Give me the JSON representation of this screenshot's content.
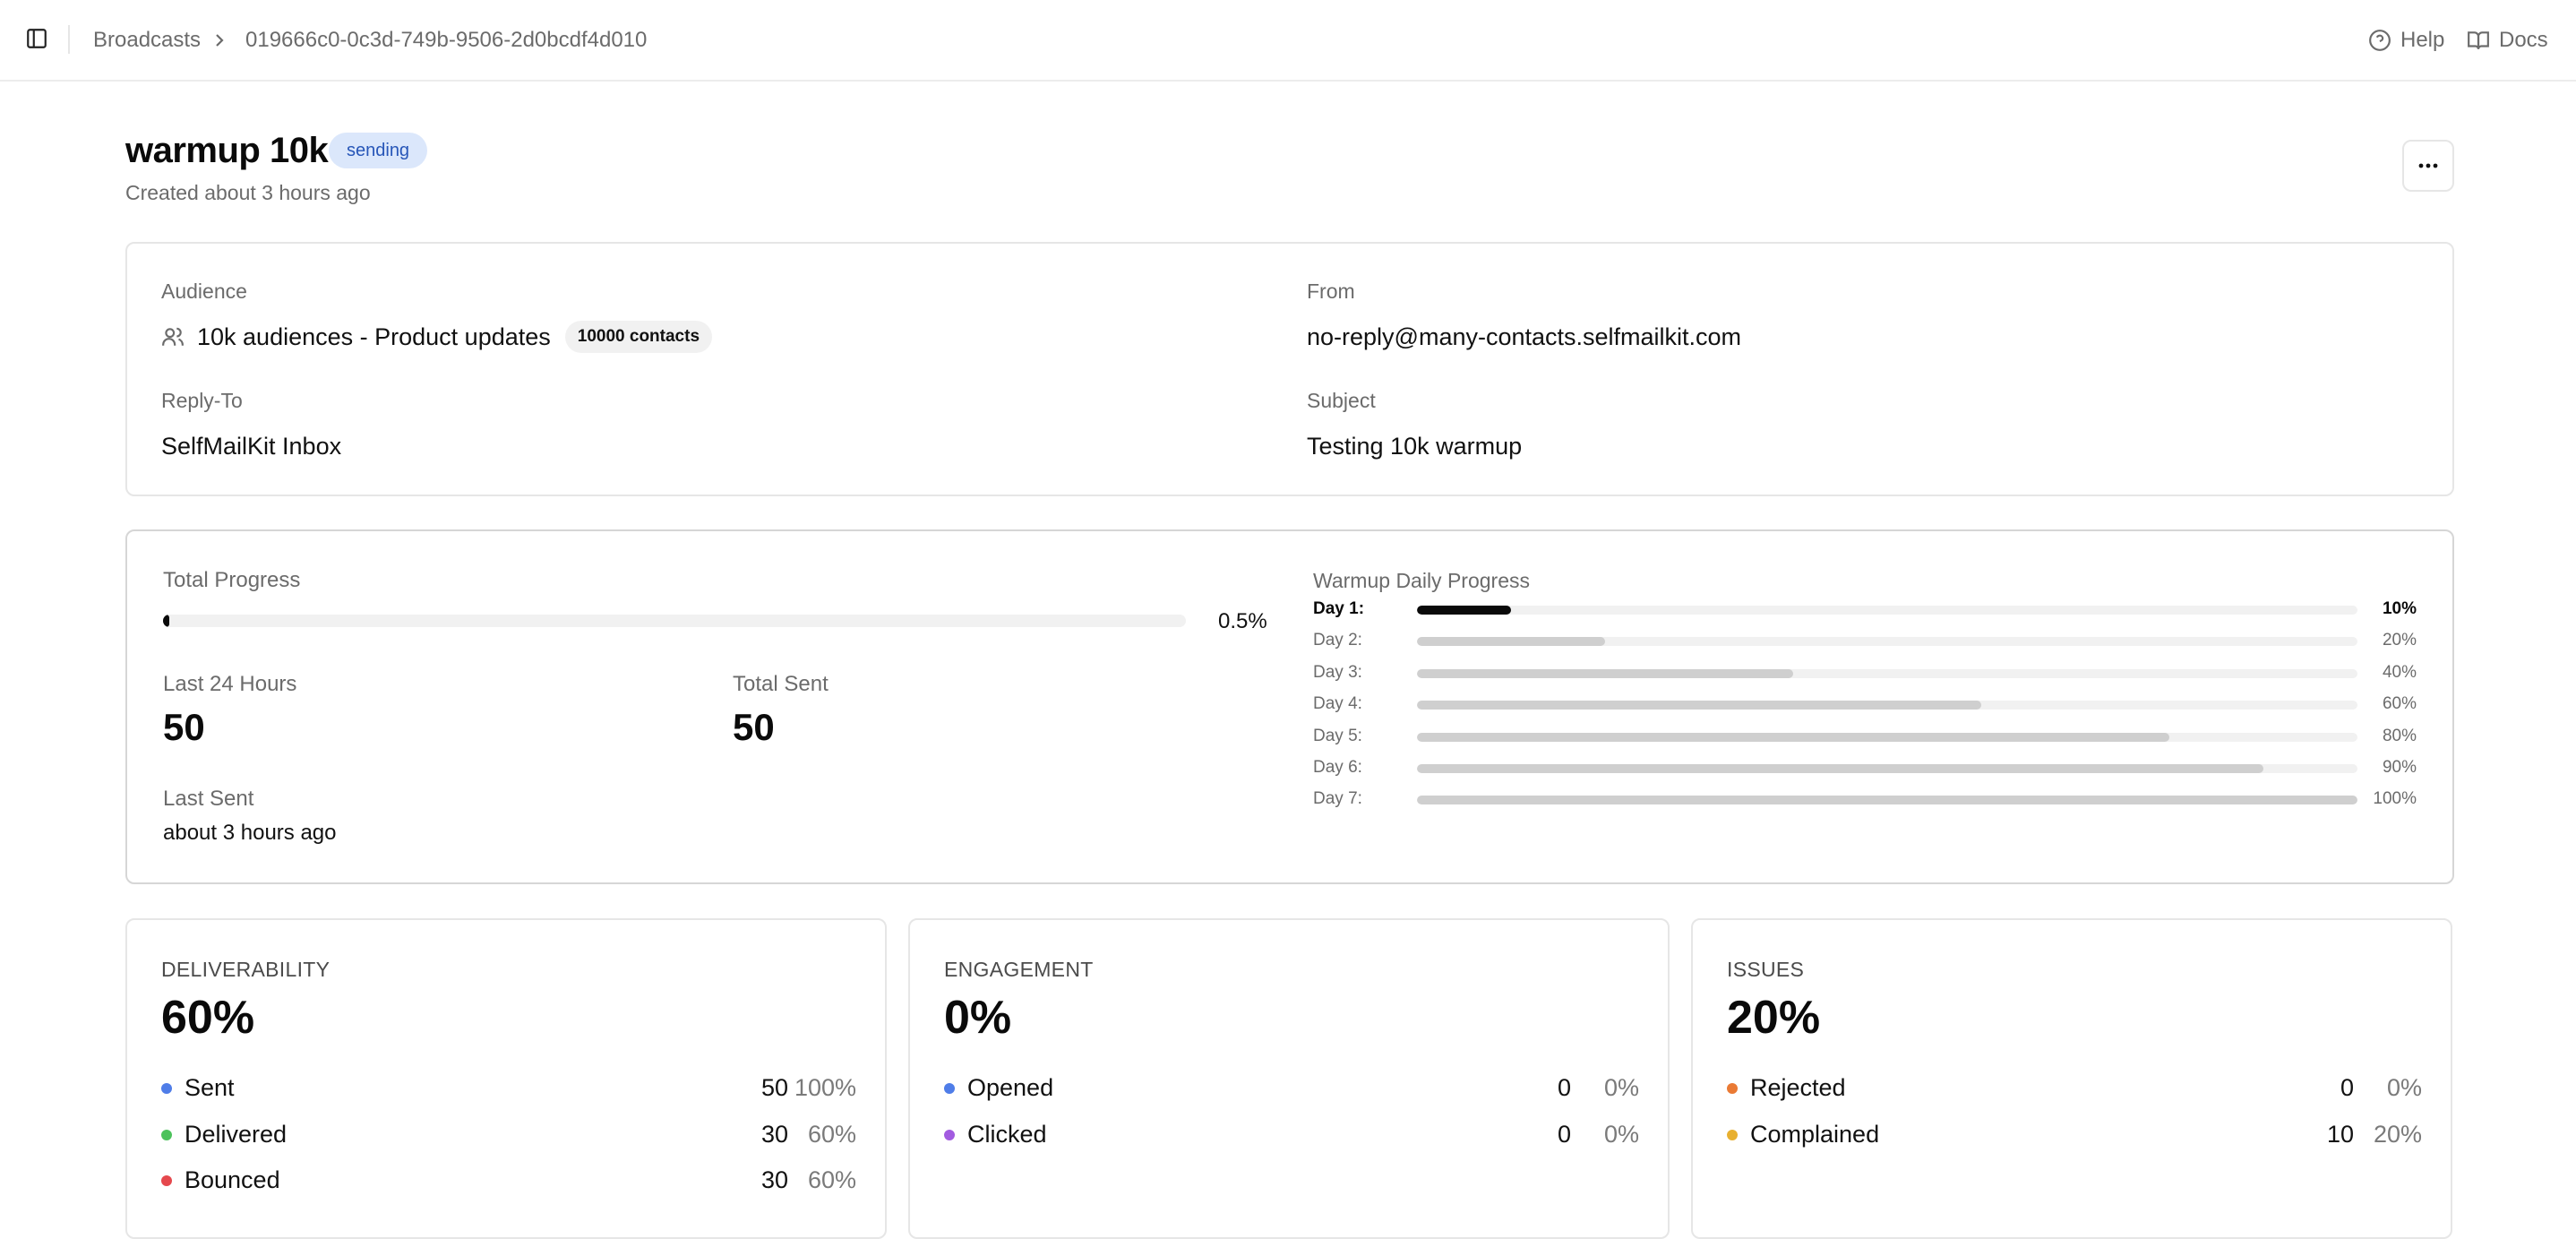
{
  "breadcrumb": {
    "parent": "Broadcasts",
    "current": "019666c0-0c3d-749b-9506-2d0bcdf4d010"
  },
  "top_links": {
    "help": "Help",
    "docs": "Docs"
  },
  "header": {
    "title": "warmup 10k",
    "status": "sending",
    "created": "Created about 3 hours ago",
    "more_label": "..."
  },
  "info": {
    "audience_label": "Audience",
    "audience_name": "10k audiences - Product updates",
    "audience_contacts": "10000 contacts",
    "from_label": "From",
    "from_value": "no-reply@many-contacts.selfmailkit.com",
    "reply_to_label": "Reply-To",
    "reply_to_value": "SelfMailKit Inbox",
    "subject_label": "Subject",
    "subject_value": "Testing 10k warmup"
  },
  "progress": {
    "total_label": "Total Progress",
    "total_pct_text": "0.5%",
    "total_fraction": 0.005,
    "last24_label": "Last 24 Hours",
    "last24_value": "50",
    "total_sent_label": "Total Sent",
    "total_sent_value": "50",
    "last_sent_label": "Last Sent",
    "last_sent_value": "about 3 hours ago"
  },
  "warmup": {
    "title": "Warmup Daily Progress",
    "days": [
      {
        "label": "Day 1:",
        "pct_text": "10%",
        "fraction": 0.1,
        "active": true
      },
      {
        "label": "Day 2:",
        "pct_text": "20%",
        "fraction": 0.2,
        "active": false
      },
      {
        "label": "Day 3:",
        "pct_text": "40%",
        "fraction": 0.4,
        "active": false
      },
      {
        "label": "Day 4:",
        "pct_text": "60%",
        "fraction": 0.6,
        "active": false
      },
      {
        "label": "Day 5:",
        "pct_text": "80%",
        "fraction": 0.8,
        "active": false
      },
      {
        "label": "Day 6:",
        "pct_text": "90%",
        "fraction": 0.9,
        "active": false
      },
      {
        "label": "Day 7:",
        "pct_text": "100%",
        "fraction": 1.0,
        "active": false
      }
    ]
  },
  "metrics": [
    {
      "title": "DELIVERABILITY",
      "value": "60%",
      "rows": [
        {
          "label": "Sent",
          "count": "50",
          "pct": "100%",
          "color": "#4f7de8"
        },
        {
          "label": "Delivered",
          "count": "30",
          "pct": "60%",
          "color": "#4cc25b"
        },
        {
          "label": "Bounced",
          "count": "30",
          "pct": "60%",
          "color": "#e5484d"
        }
      ]
    },
    {
      "title": "ENGAGEMENT",
      "value": "0%",
      "rows": [
        {
          "label": "Opened",
          "count": "0",
          "pct": "0%",
          "color": "#4f7de8"
        },
        {
          "label": "Clicked",
          "count": "0",
          "pct": "0%",
          "color": "#a25be0"
        }
      ]
    },
    {
      "title": "ISSUES",
      "value": "20%",
      "rows": [
        {
          "label": "Rejected",
          "count": "0",
          "pct": "0%",
          "color": "#ea7a34"
        },
        {
          "label": "Complained",
          "count": "10",
          "pct": "20%",
          "color": "#e8b030"
        }
      ]
    }
  ]
}
